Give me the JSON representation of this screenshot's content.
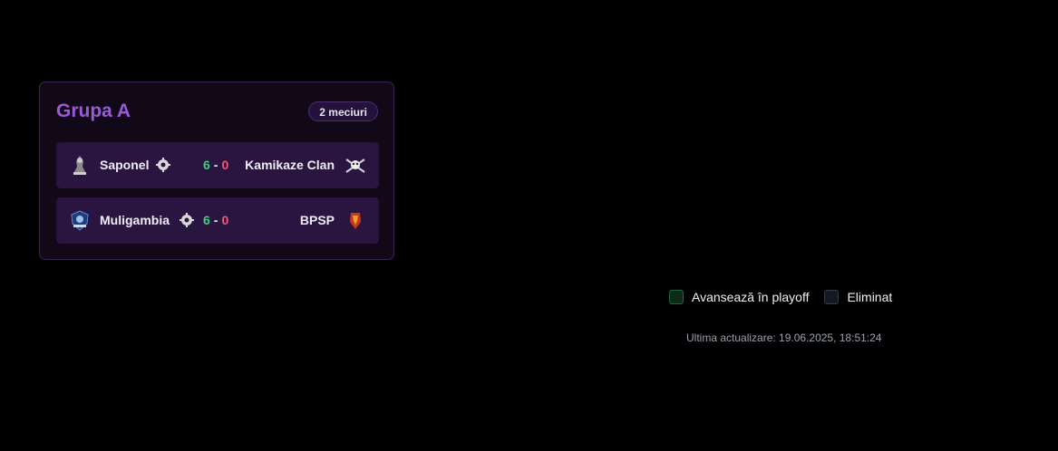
{
  "group": {
    "title": "Grupa A",
    "badge": "2 meciuri",
    "matches": [
      {
        "home": "Saponel",
        "home_logo": "saponel-logo",
        "home_score": "6",
        "separator": "-",
        "away_score": "0",
        "away": "Kamikaze Clan",
        "away_logo": "kamikaze-clan-logo"
      },
      {
        "home": "Muligambia",
        "home_logo": "muligambia-logo",
        "home_score": "6",
        "separator": "-",
        "away_score": "0",
        "away": "BPSP",
        "away_logo": "bpsp-logo"
      }
    ]
  },
  "legend": {
    "advance": "Avansează în playoff",
    "eliminated": "Eliminat"
  },
  "last_update": "Ultima actualizare: 19.06.2025, 18:51:24",
  "colors": {
    "background": "#000000",
    "card": "#120918",
    "match_row": "#2a1540",
    "title": "#9b5ad8",
    "win": "#39d07a",
    "loss": "#f0597a"
  }
}
